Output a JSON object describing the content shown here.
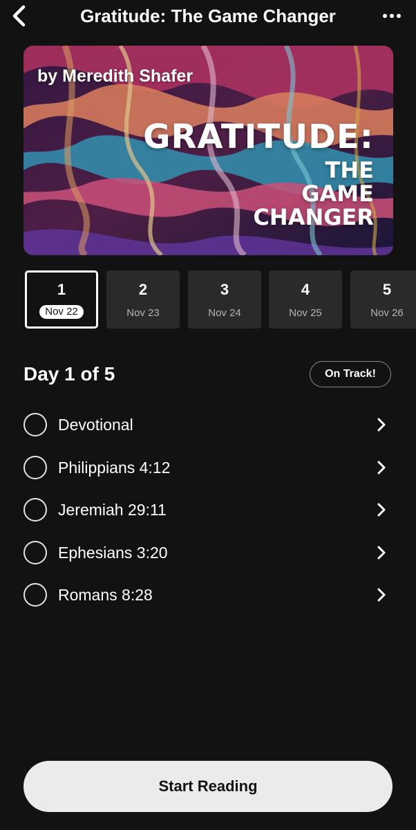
{
  "header": {
    "title": "Gratitude: The Game Changer",
    "back_icon": "chevron-left-icon",
    "more_icon": "more-horizontal-icon"
  },
  "hero": {
    "author": "by Meredith Shafer",
    "title_line1": "GRATITUDE:",
    "title_line2": "THE",
    "title_line3": "GAME",
    "title_line4": "CHANGER"
  },
  "days": [
    {
      "num": "1",
      "date": "Nov 22",
      "selected": true
    },
    {
      "num": "2",
      "date": "Nov 23",
      "selected": false
    },
    {
      "num": "3",
      "date": "Nov 24",
      "selected": false
    },
    {
      "num": "4",
      "date": "Nov 25",
      "selected": false
    },
    {
      "num": "5",
      "date": "Nov 26",
      "selected": false
    }
  ],
  "progress": {
    "heading": "Day 1 of 5",
    "status": "On Track!"
  },
  "readings": [
    {
      "label": "Devotional",
      "completed": false
    },
    {
      "label": "Philippians 4:12",
      "completed": false
    },
    {
      "label": "Jeremiah 29:11",
      "completed": false
    },
    {
      "label": "Ephesians 3:20",
      "completed": false
    },
    {
      "label": "Romans 8:28",
      "completed": false
    }
  ],
  "footer": {
    "start_label": "Start Reading"
  },
  "colors": {
    "background": "#121212",
    "day_tile": "#2a2a2a",
    "button": "#ebebeb"
  }
}
